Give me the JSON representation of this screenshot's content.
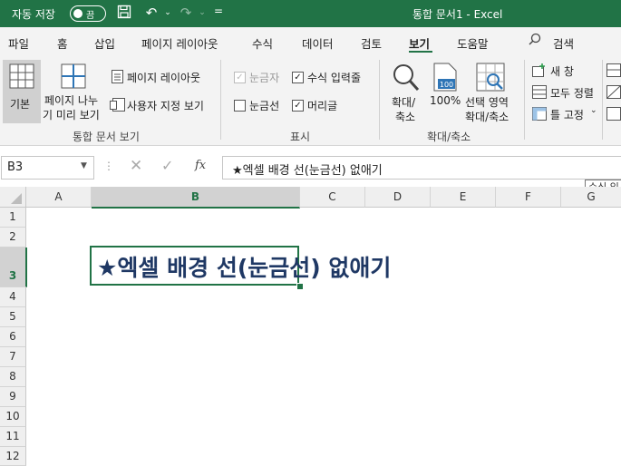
{
  "titlebar": {
    "autosave_label": "자동 저장",
    "autosave_state": "끔",
    "more_label": "=",
    "doc_title": "통합 문서1  -  Excel"
  },
  "tabs": [
    "파일",
    "홈",
    "삽입",
    "페이지 레이아웃",
    "수식",
    "데이터",
    "검토",
    "보기",
    "도움말"
  ],
  "active_tab": "보기",
  "search_label": "검색",
  "ribbon": {
    "normal_label": "기본",
    "page_break_preview_line1": "페이지 나누",
    "page_break_preview_line2": "기 미리 보기",
    "page_layout_label": "페이지 레이아웃",
    "custom_views_label": "사용자 지정 보기",
    "workbook_views_group": "통합 문서 보기",
    "ruler_label": "눈금자",
    "formula_bar_label": "수식 입력줄",
    "gridlines_label": "눈금선",
    "headings_label": "머리글",
    "show_group": "표시",
    "zoom_label_1": "확대/",
    "zoom_label_2": "축소",
    "zoom100_label": "100%",
    "zoom_selection_1": "선택 영역",
    "zoom_selection_2": "확대/축소",
    "zoom_group": "확대/축소",
    "new_window_label": "새 창",
    "arrange_all_label": "모두 정렬",
    "freeze_panes_label": "틀 고정"
  },
  "formula_bar": {
    "name_box": "B3",
    "formula": "★엑셀 배경 선(눈금선) 없애기",
    "tooltip": "수식 입"
  },
  "columns": [
    "A",
    "B",
    "C",
    "D",
    "E",
    "F",
    "G"
  ],
  "rows": [
    "1",
    "2",
    "3",
    "4",
    "5",
    "6",
    "7",
    "8",
    "9",
    "10",
    "11",
    "12"
  ],
  "cell_b3": "★엑셀 배경 선(눈금선) 없애기",
  "colors": {
    "excel_green": "#217346",
    "cell_text": "#1f3864"
  }
}
